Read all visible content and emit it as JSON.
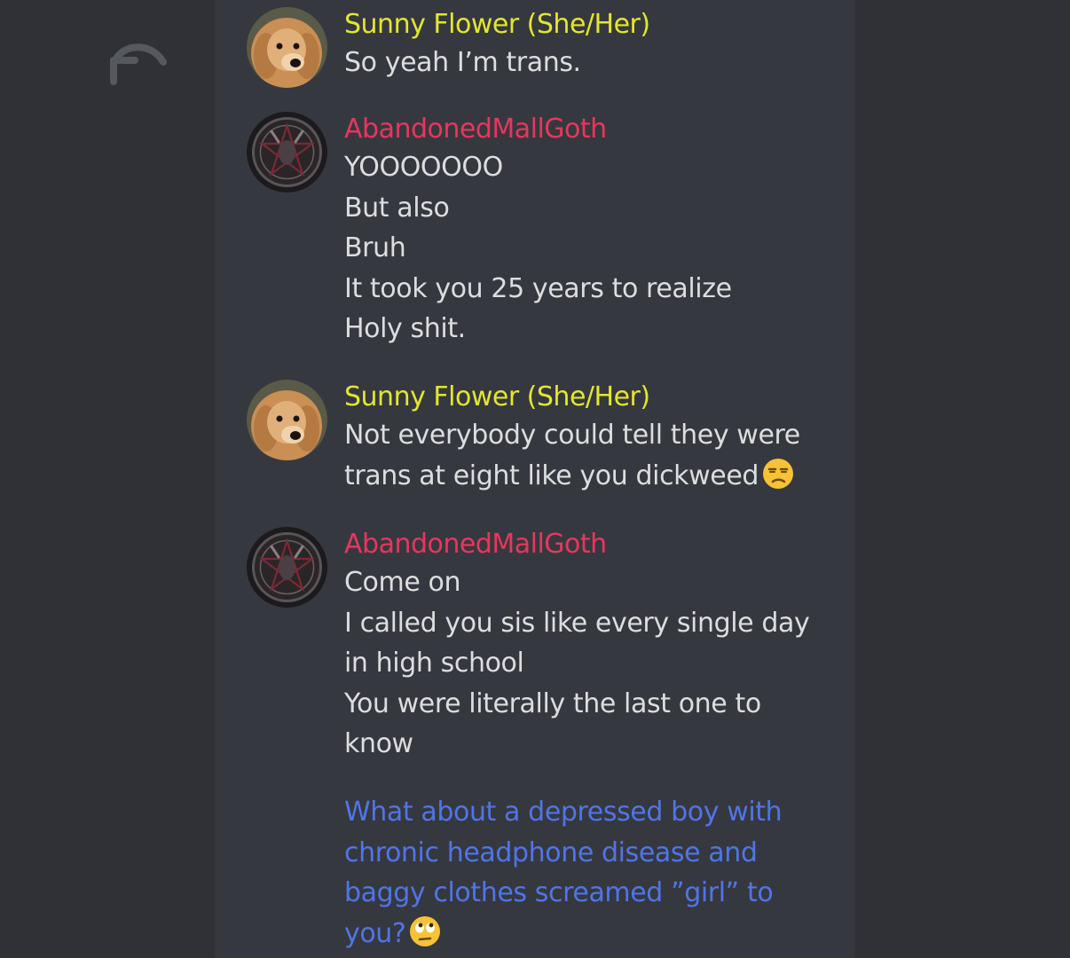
{
  "colors": {
    "background": "#2f3137",
    "panel": "#36383f",
    "text": "#dcddde",
    "sunny_name": "#e3e62e",
    "goth_name": "#e8365d",
    "self_text": "#4f75e8"
  },
  "toolbar": {
    "undo_icon": "undo-arrow-icon"
  },
  "messages": [
    {
      "author": "Sunny Flower (She/Her)",
      "avatar": "golden-puppy-avatar",
      "lines": [
        "So yeah I’m trans."
      ]
    },
    {
      "author": "AbandonedMallGoth",
      "avatar": "pentagram-goat-avatar",
      "lines": [
        "YOOOOOOO",
        "But also",
        "Bruh",
        "It took you 25 years to realize",
        "Holy shit."
      ]
    },
    {
      "author": "Sunny Flower (She/Her)",
      "avatar": "golden-puppy-avatar",
      "lines": [
        "Not everybody could tell they were",
        "trans at eight like you dickweed"
      ],
      "trailing_emoji": "unamused-face-emoji"
    },
    {
      "author": "AbandonedMallGoth",
      "avatar": "pentagram-goat-avatar",
      "lines": [
        "Come on",
        "I called you sis like every single day",
        "in high school",
        "You were literally the last one to",
        "know"
      ]
    },
    {
      "lines": [
        "What about a depressed boy with",
        "chronic headphone disease and",
        "baggy clothes screamed ”girl” to",
        "you?"
      ],
      "trailing_emoji": "eye-roll-face-emoji"
    }
  ]
}
